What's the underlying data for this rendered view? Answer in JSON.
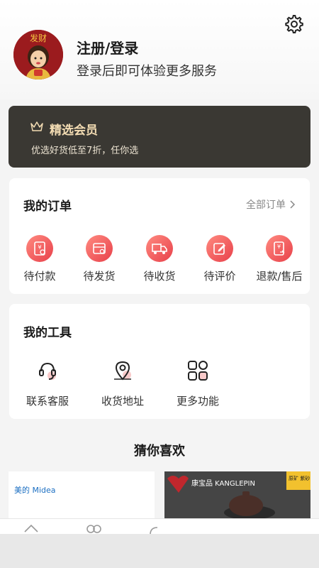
{
  "profile": {
    "title": "注册/登录",
    "subtitle": "登录后即可体验更多服务",
    "avatar_text": "发财"
  },
  "vip": {
    "title": "精选会员",
    "subtitle": "优选好货低至7折，任你选"
  },
  "orders": {
    "title": "我的订单",
    "all_label": "全部订单",
    "items": [
      {
        "label": "待付款",
        "icon": "yen-card-icon"
      },
      {
        "label": "待发货",
        "icon": "box-icon"
      },
      {
        "label": "待收货",
        "icon": "truck-icon"
      },
      {
        "label": "待评价",
        "icon": "edit-icon"
      },
      {
        "label": "退款/售后",
        "icon": "refund-icon"
      }
    ]
  },
  "tools": {
    "title": "我的工具",
    "items": [
      {
        "label": "联系客服",
        "icon": "headset-icon"
      },
      {
        "label": "收货地址",
        "icon": "location-pin-icon"
      },
      {
        "label": "更多功能",
        "icon": "grid-apps-icon"
      }
    ]
  },
  "recommend": {
    "title": "猜你喜欢",
    "products": [
      {
        "brand": "美的 Midea"
      },
      {
        "brand": "康宝品 KANGLEPIN",
        "tag": "原矿 紫砂"
      }
    ]
  },
  "colors": {
    "accent": "#e8404a",
    "vip_bg": "#3a3833",
    "vip_text": "#f3dcb3"
  }
}
